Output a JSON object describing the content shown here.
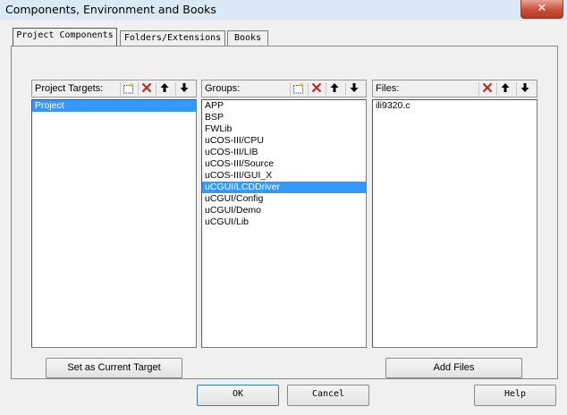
{
  "window": {
    "title": "Components, Environment and Books"
  },
  "tabs": [
    {
      "label": "Project Components",
      "active": true
    },
    {
      "label": "Folders/Extensions",
      "active": false
    },
    {
      "label": "Books",
      "active": false
    }
  ],
  "targets_pane": {
    "label": "Project Targets:",
    "items": [
      {
        "text": "Project",
        "selected": true
      }
    ],
    "button_label": "Set as Current Target"
  },
  "groups_pane": {
    "label": "Groups:",
    "items": [
      {
        "text": "APP"
      },
      {
        "text": "BSP"
      },
      {
        "text": "FWLib"
      },
      {
        "text": "uCOS-III/CPU"
      },
      {
        "text": "uCOS-III/LIB"
      },
      {
        "text": "uCOS-III/Source"
      },
      {
        "text": "uCOS-III/GUI_X"
      },
      {
        "text": "uCGUI/LCDDriver",
        "selected": true
      },
      {
        "text": "uCGUI/Config"
      },
      {
        "text": "uCGUI/Demo"
      },
      {
        "text": "uCGUI/Lib"
      }
    ]
  },
  "files_pane": {
    "label": "Files:",
    "items": [
      {
        "text": "ili9320.c"
      }
    ],
    "button_label": "Add Files"
  },
  "footer": {
    "ok": "OK",
    "cancel": "Cancel",
    "help": "Help"
  },
  "icons": {
    "new": "new-item-icon",
    "delete": "delete-icon",
    "up": "move-up-icon",
    "down": "move-down-icon",
    "close": "close-icon"
  },
  "colors": {
    "selection": "#3399ff",
    "delete_red": "#c0201a",
    "dialog_bg": "#f0f0f0"
  }
}
